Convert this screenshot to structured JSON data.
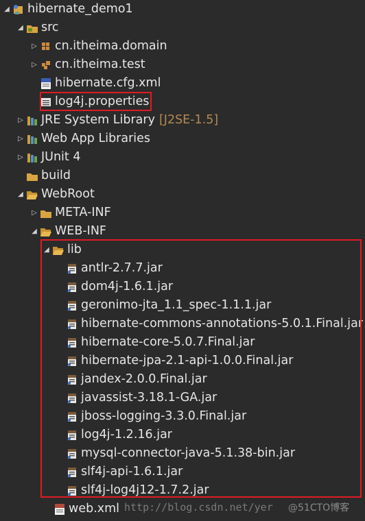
{
  "project": {
    "label": "hibernate_demo1"
  },
  "src": {
    "label": "src"
  },
  "packages": [
    {
      "label": "cn.itheima.domain"
    },
    {
      "label": "cn.itheima.test"
    }
  ],
  "src_files": [
    {
      "label": "hibernate.cfg.xml"
    },
    {
      "label": "log4j.properties"
    }
  ],
  "libraries": [
    {
      "label": "JRE System Library",
      "decoration": "[J2SE-1.5]"
    },
    {
      "label": "Web App Libraries"
    },
    {
      "label": "JUnit 4"
    }
  ],
  "build": {
    "label": "build"
  },
  "webroot": {
    "label": "WebRoot"
  },
  "meta_inf": {
    "label": "META-INF"
  },
  "web_inf": {
    "label": "WEB-INF"
  },
  "lib": {
    "label": "lib"
  },
  "jars": [
    {
      "label": "antlr-2.7.7.jar"
    },
    {
      "label": "dom4j-1.6.1.jar"
    },
    {
      "label": "geronimo-jta_1.1_spec-1.1.1.jar"
    },
    {
      "label": "hibernate-commons-annotations-5.0.1.Final.jar"
    },
    {
      "label": "hibernate-core-5.0.7.Final.jar"
    },
    {
      "label": "hibernate-jpa-2.1-api-1.0.0.Final.jar"
    },
    {
      "label": "jandex-2.0.0.Final.jar"
    },
    {
      "label": "javassist-3.18.1-GA.jar"
    },
    {
      "label": "jboss-logging-3.3.0.Final.jar"
    },
    {
      "label": "log4j-1.2.16.jar"
    },
    {
      "label": "mysql-connector-java-5.1.38-bin.jar"
    },
    {
      "label": "slf4j-api-1.6.1.jar"
    },
    {
      "label": "slf4j-log4j12-1.7.2.jar"
    }
  ],
  "web_xml": {
    "label": "web.xml"
  },
  "watermark": {
    "text": "http://blog.csdn.net/yer",
    "text2": "@51CTO博客"
  },
  "colors": {
    "background": "#2b2b2b",
    "text": "#e6e6e6",
    "highlight": "#e01b24",
    "decoration": "#b48a52"
  }
}
